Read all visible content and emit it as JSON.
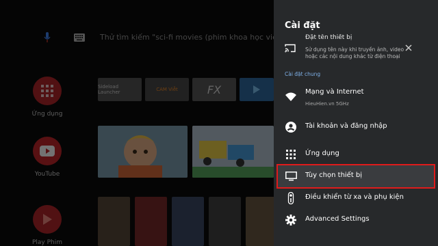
{
  "home": {
    "search_hint": "Thử tìm kiếm \"sci-fi movies (phim khoa học viễn tưởng)\"",
    "rail": [
      {
        "label": "Ứng dụng"
      },
      {
        "label": "YouTube"
      },
      {
        "label": "Play Phim"
      }
    ],
    "app_tiles": [
      {
        "label": "Sideload Launcher"
      },
      {
        "label": "CAM Viễt"
      },
      {
        "label": "FX"
      },
      {
        "label": ""
      }
    ]
  },
  "settings": {
    "title": "Cài đặt",
    "device_name": {
      "title": "Đặt tên thiết bị",
      "description": "Sử dụng tên này khi truyền ảnh, video hoặc các nội dung khác từ điện thoại"
    },
    "section_header": "Cài đặt chung",
    "items": [
      {
        "label": "Mạng và Internet",
        "sublabel": "HieuHien.vn 5GHz",
        "icon": "wifi-icon"
      },
      {
        "label": "Tài khoản và đăng nhập",
        "icon": "account-icon"
      },
      {
        "label": "Ứng dụng",
        "icon": "apps-grid-icon"
      },
      {
        "label": "Tùy chọn thiết bị",
        "icon": "tv-icon",
        "selected": true
      },
      {
        "label": "Điều khiển từ xa và phụ kiện",
        "icon": "remote-icon"
      },
      {
        "label": "Advanced Settings",
        "icon": "gear-icon"
      }
    ],
    "colors": {
      "panel_bg": "#27292b",
      "section_header": "#7fb1e8",
      "selection_border": "#e01b1b"
    }
  }
}
